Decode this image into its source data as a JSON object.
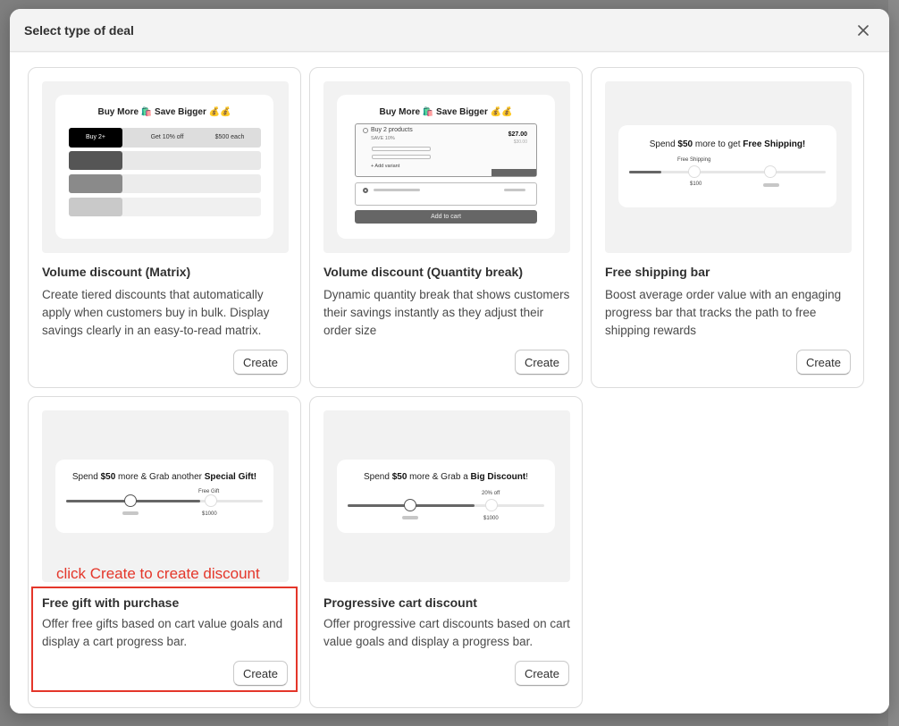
{
  "modal": {
    "title": "Select type of deal",
    "close_icon": "close-icon"
  },
  "cards": [
    {
      "title": "Volume discount (Matrix)",
      "description": "Create tiered discounts that automatically apply when customers buy in bulk. Display savings clearly in an easy-to-read matrix.",
      "button": "Create",
      "preview": {
        "heading": "Buy More 🛍️ Save Bigger 💰💰",
        "row1": [
          "Buy 2+",
          "Get 10% off",
          "$500 each"
        ]
      }
    },
    {
      "title": "Volume discount (Quantity break)",
      "description": "Dynamic quantity break that shows customers their savings instantly as they adjust their order size",
      "button": "Create",
      "preview": {
        "heading": "Buy More 🛍️ Save Bigger 💰💰",
        "option_label": "Buy 2 products",
        "save_label": "SAVE 10%",
        "price": "$27.00",
        "old_price": "$30.00",
        "add_variant": "+ Add variant",
        "add_to_cart": "Add to cart"
      }
    },
    {
      "title": "Free shipping bar",
      "description": "Boost average order value with an engaging progress bar that tracks the path to free shipping rewards",
      "button": "Create",
      "preview": {
        "heading_pre": "Spend",
        "heading_amount": "$50",
        "heading_mid": "more to get",
        "heading_goal": "Free Shipping!",
        "milestone_label": "Free Shipping",
        "milestone_value": "$100"
      }
    },
    {
      "title": "Free gift with purchase",
      "description": "Offer free gifts based on cart value goals and display a cart progress bar.",
      "button": "Create",
      "preview": {
        "heading_pre": "Spend",
        "heading_amount": "$50",
        "heading_mid": "more & Grab another",
        "heading_goal": "Special Gift!",
        "milestone_label": "Free Gift",
        "milestone_value": "$1000"
      }
    },
    {
      "title": "Progressive cart discount",
      "description": "Offer progressive cart discounts based on cart value goals and display a progress bar.",
      "button": "Create",
      "preview": {
        "heading_pre": "Spend",
        "heading_amount": "$50",
        "heading_mid": "more & Grab a",
        "heading_goal": "Big Discount",
        "heading_end": "!",
        "milestone_label": "20% off",
        "milestone_value": "$1000"
      }
    }
  ],
  "annotation": {
    "text": "click Create to create discount",
    "color": "#e4362a"
  }
}
